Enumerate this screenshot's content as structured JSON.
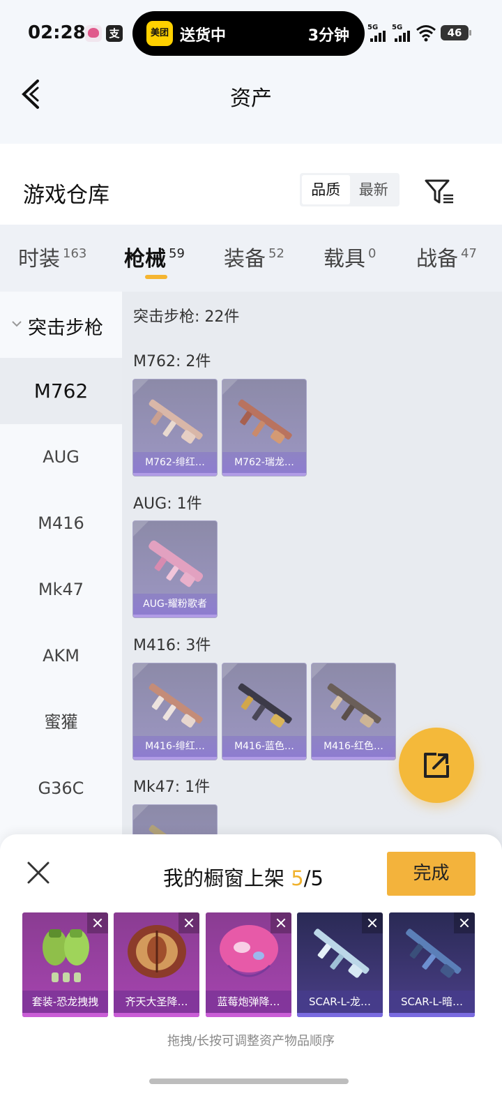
{
  "status": {
    "time": "02:28",
    "island_app": "美团",
    "island_text": "送货中",
    "island_eta": "3分钟",
    "sig1": "5G",
    "sig2": "5G",
    "battery": "46"
  },
  "header": {
    "title": "资产"
  },
  "warehouse": {
    "title": "游戏仓库",
    "sort": [
      "品质",
      "最新"
    ],
    "sort_active": "品质"
  },
  "tabs": [
    {
      "label": "时装",
      "count": "163"
    },
    {
      "label": "枪械",
      "count": "59",
      "active": true
    },
    {
      "label": "装备",
      "count": "52"
    },
    {
      "label": "载具",
      "count": "0"
    },
    {
      "label": "战备",
      "count": "47"
    }
  ],
  "sidebar": {
    "group": "突击步枪",
    "items": [
      "M762",
      "AUG",
      "M416",
      "Mk47",
      "AKM",
      "蜜獾",
      "G36C"
    ],
    "active": "M762"
  },
  "content": {
    "total": "突击步枪: 22件",
    "sections": [
      {
        "title": "M762: 2件",
        "items": [
          "M762-绯红…",
          "M762-瑞龙…"
        ]
      },
      {
        "title": "AUG: 1件",
        "items": [
          "AUG-耀粉歌者"
        ]
      },
      {
        "title": "M416: 3件",
        "items": [
          "M416-绯红…",
          "M416-蓝色…",
          "M416-红色…"
        ]
      },
      {
        "title": "Mk47: 1件",
        "items": []
      }
    ]
  },
  "sheet": {
    "title_prefix": "我的橱窗上架",
    "count_current": "5",
    "count_sep": "/",
    "count_total": "5",
    "done_label": "完成",
    "tiles": [
      "套装-恐龙拽拽",
      "齐天大圣降…",
      "蓝莓炮弹降…",
      "SCAR-L-龙…",
      "SCAR-L-暗…"
    ],
    "hint": "拖拽/长按可调整资产物品顺序"
  },
  "colors": {
    "accent": "#f3b33c",
    "highlight": "#f0b22e",
    "card_purple": "#9d97c4",
    "tile_purple": "#a645b0",
    "tile_navy": "#4b3f88"
  }
}
